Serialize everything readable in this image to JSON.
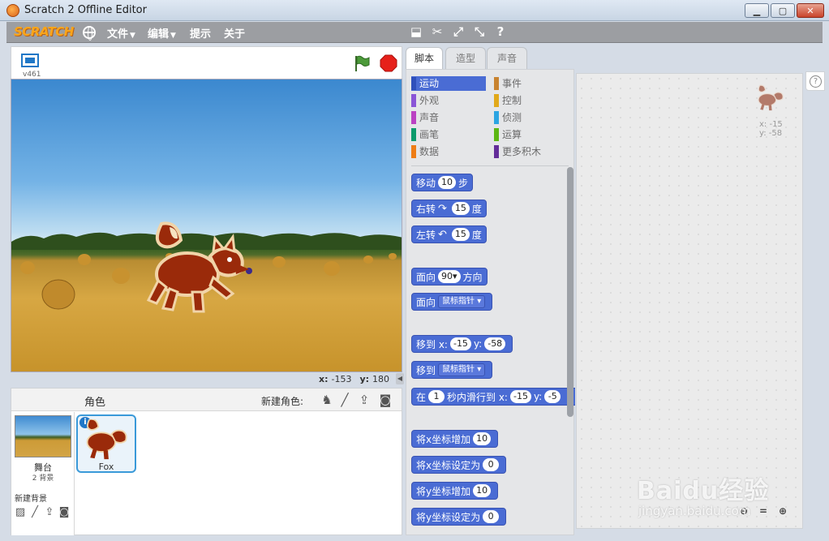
{
  "window": {
    "title": "Scratch 2 Offline Editor"
  },
  "menu": {
    "logo": "SCRATCH",
    "file": "文件",
    "edit": "编辑",
    "tips": "提示",
    "about": "关于"
  },
  "stage": {
    "version": "v461",
    "mouse_x_label": "x:",
    "mouse_x": "-153",
    "mouse_y_label": "y:",
    "mouse_y": "180"
  },
  "sprites_pane": {
    "title": "角色",
    "new_sprite_label": "新建角色:",
    "stage_label": "舞台",
    "backdrop_count": "2 背景",
    "new_backdrop_label": "新建背景",
    "sprite_name": "Fox",
    "info_badge": "i"
  },
  "tabs": {
    "scripts": "脚本",
    "costumes": "造型",
    "sounds": "声音"
  },
  "categories": [
    {
      "label": "运动",
      "color": "#4a6cd4"
    },
    {
      "label": "事件",
      "color": "#c88330"
    },
    {
      "label": "外观",
      "color": "#8a55d7"
    },
    {
      "label": "控制",
      "color": "#e1a91a"
    },
    {
      "label": "声音",
      "color": "#bb42c3"
    },
    {
      "label": "侦测",
      "color": "#2ca5e2"
    },
    {
      "label": "画笔",
      "color": "#0e9a6c"
    },
    {
      "label": "运算",
      "color": "#5cb712"
    },
    {
      "label": "数据",
      "color": "#ee7d16"
    },
    {
      "label": "更多积木",
      "color": "#632d99"
    }
  ],
  "blocks": {
    "move": {
      "pre": "移动",
      "val": "10",
      "post": "步"
    },
    "turn_right": {
      "pre": "右转",
      "icon": "↷",
      "val": "15",
      "post": "度"
    },
    "turn_left": {
      "pre": "左转",
      "icon": "↶",
      "val": "15",
      "post": "度"
    },
    "point_dir": {
      "pre": "面向",
      "val": "90▾",
      "post": "方向"
    },
    "point_towards": {
      "pre": "面向",
      "drop": "鼠标指针 ▾"
    },
    "goto_xy": {
      "pre": "移到 x:",
      "x": "-15",
      "ylabel": "y:",
      "y": "-58"
    },
    "goto_target": {
      "pre": "移到",
      "drop": "鼠标指针 ▾"
    },
    "glide": {
      "pre": "在",
      "secs": "1",
      "mid": "秒内滑行到 x:",
      "x": "-15",
      "ylabel": "y:",
      "y": "-5"
    },
    "change_x": {
      "pre": "将x坐标增加",
      "val": "10"
    },
    "set_x": {
      "pre": "将x坐标设定为",
      "val": "0"
    },
    "change_y": {
      "pre": "将y坐标增加",
      "val": "10"
    },
    "set_y": {
      "pre": "将y坐标设定为",
      "val": "0"
    }
  },
  "script_area": {
    "x_label": "x: -15",
    "y_label": "y: -58"
  },
  "watermark": {
    "main": "Baidu经验",
    "sub": "jingyan.baidu.com"
  },
  "colors": {
    "motion": "#4a6cd4",
    "menubar": "#9c9ea2",
    "logo": "#f9a51a"
  }
}
